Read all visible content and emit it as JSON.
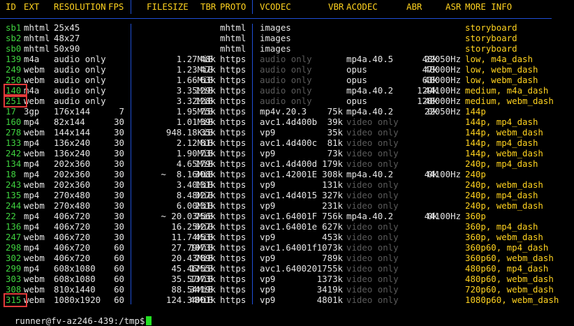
{
  "header": {
    "id": "ID",
    "ext": "EXT",
    "resolution": "RESOLUTION",
    "fps": "FPS",
    "filesize": "FILESIZE",
    "tbr": "TBR",
    "proto": "PROTO",
    "vcodec": "VCODEC",
    "vbr": "VBR",
    "acodec": "ACODEC",
    "abr": "ABR",
    "asr": "ASR",
    "more": "MORE INFO"
  },
  "rows": [
    {
      "id": "sb1",
      "ext": "mhtml",
      "res": "25x45",
      "fps": "",
      "size": "",
      "tbr": "",
      "proto": "mhtml",
      "vcodec": "images",
      "vcodec_dim": false,
      "vbr": "",
      "acodec": "",
      "abr": "",
      "asr": "",
      "more": "storyboard"
    },
    {
      "id": "sb2",
      "ext": "mhtml",
      "res": "48x27",
      "fps": "",
      "size": "",
      "tbr": "",
      "proto": "mhtml",
      "vcodec": "images",
      "vcodec_dim": false,
      "vbr": "",
      "acodec": "",
      "abr": "",
      "asr": "",
      "more": "storyboard"
    },
    {
      "id": "sb0",
      "ext": "mhtml",
      "res": "50x90",
      "fps": "",
      "size": "",
      "tbr": "",
      "proto": "mhtml",
      "vcodec": "images",
      "vcodec_dim": false,
      "vbr": "",
      "acodec": "",
      "abr": "",
      "asr": "",
      "more": "storyboard"
    },
    {
      "id": "139",
      "ext": "m4a",
      "res": "audio only",
      "fps": "",
      "size": "1.27MiB",
      "tbr": "48k",
      "proto": "https",
      "vcodec": "audio only",
      "vcodec_dim": true,
      "vbr": "",
      "acodec": "mp4a.40.5",
      "abr": "48k",
      "asr": "22050Hz",
      "more": "low, m4a_dash"
    },
    {
      "id": "249",
      "ext": "webm",
      "res": "audio only",
      "fps": "",
      "size": "1.23MiB",
      "tbr": "47k",
      "proto": "https",
      "vcodec": "audio only",
      "vcodec_dim": true,
      "vbr": "",
      "acodec": "opus",
      "abr": "47k",
      "asr": "48000Hz",
      "more": "low, webm_dash"
    },
    {
      "id": "250",
      "ext": "webm",
      "res": "audio only",
      "fps": "",
      "size": "1.66MiB",
      "tbr": "63k",
      "proto": "https",
      "vcodec": "audio only",
      "vcodec_dim": true,
      "vbr": "",
      "acodec": "opus",
      "abr": "63k",
      "asr": "48000Hz",
      "more": "low, webm_dash"
    },
    {
      "id": "140",
      "ext": "m4a",
      "res": "audio only",
      "fps": "",
      "size": "3.35MiB",
      "tbr": "129k",
      "proto": "https",
      "vcodec": "audio only",
      "vcodec_dim": true,
      "vbr": "",
      "acodec": "mp4a.40.2",
      "abr": "129k",
      "asr": "44100Hz",
      "more": "medium, m4a_dash"
    },
    {
      "id": "251",
      "ext": "webm",
      "res": "audio only",
      "fps": "",
      "size": "3.32MiB",
      "tbr": "128k",
      "proto": "https",
      "vcodec": "audio only",
      "vcodec_dim": true,
      "vbr": "",
      "acodec": "opus",
      "abr": "128k",
      "asr": "48000Hz",
      "more": "medium, webm_dash"
    },
    {
      "id": "17",
      "ext": "3gp",
      "res": "176x144",
      "fps": "7",
      "size": "1.95MiB",
      "tbr": "75k",
      "proto": "https",
      "vcodec": "mp4v.20.3",
      "vcodec_dim": false,
      "vbr": "75k",
      "acodec": "mp4a.40.2",
      "abr": "0k",
      "asr": "22050Hz",
      "more": "144p"
    },
    {
      "id": "160",
      "ext": "mp4",
      "res": "82x144",
      "fps": "30",
      "size": "1.01MiB",
      "tbr": "39k",
      "proto": "https",
      "vcodec": "avc1.4d400b",
      "vcodec_dim": false,
      "vbr": "39k",
      "acodec": "video only",
      "acodec_dim": true,
      "abr": "",
      "asr": "",
      "more": "144p, mp4_dash"
    },
    {
      "id": "278",
      "ext": "webm",
      "res": "144x144",
      "fps": "30",
      "size": "948.18KiB",
      "tbr": "35k",
      "proto": "https",
      "vcodec": "vp9",
      "vcodec_dim": false,
      "vbr": "35k",
      "acodec": "video only",
      "acodec_dim": true,
      "abr": "",
      "asr": "",
      "more": "144p, webm_dash"
    },
    {
      "id": "133",
      "ext": "mp4",
      "res": "136x240",
      "fps": "30",
      "size": "2.12MiB",
      "tbr": "81k",
      "proto": "https",
      "vcodec": "avc1.4d400c",
      "vcodec_dim": false,
      "vbr": "81k",
      "acodec": "video only",
      "acodec_dim": true,
      "abr": "",
      "asr": "",
      "more": "144p, mp4_dash"
    },
    {
      "id": "242",
      "ext": "webm",
      "res": "136x240",
      "fps": "30",
      "size": "1.90MiB",
      "tbr": "73k",
      "proto": "https",
      "vcodec": "vp9",
      "vcodec_dim": false,
      "vbr": "73k",
      "acodec": "video only",
      "acodec_dim": true,
      "abr": "",
      "asr": "",
      "more": "144p, webm_dash"
    },
    {
      "id": "134",
      "ext": "mp4",
      "res": "202x360",
      "fps": "30",
      "size": "4.65MiB",
      "tbr": "179k",
      "proto": "https",
      "vcodec": "avc1.4d400d",
      "vcodec_dim": false,
      "vbr": "179k",
      "acodec": "video only",
      "acodec_dim": true,
      "abr": "",
      "asr": "",
      "more": "240p, mp4_dash"
    },
    {
      "id": "18",
      "ext": "mp4",
      "res": "202x360",
      "fps": "30",
      "size": "~  8.16MiB",
      "tbr": "308k",
      "proto": "https",
      "vcodec": "avc1.42001E",
      "vcodec_dim": false,
      "vbr": "308k",
      "acodec": "mp4a.40.2",
      "abr": "0k",
      "asr": "44100Hz",
      "more": "240p"
    },
    {
      "id": "243",
      "ext": "webm",
      "res": "202x360",
      "fps": "30",
      "size": "3.40MiB",
      "tbr": "131k",
      "proto": "https",
      "vcodec": "vp9",
      "vcodec_dim": false,
      "vbr": "131k",
      "acodec": "video only",
      "acodec_dim": true,
      "abr": "",
      "asr": "",
      "more": "240p, webm_dash"
    },
    {
      "id": "135",
      "ext": "mp4",
      "res": "270x480",
      "fps": "30",
      "size": "8.48MiB",
      "tbr": "327k",
      "proto": "https",
      "vcodec": "avc1.4d4015",
      "vcodec_dim": false,
      "vbr": "327k",
      "acodec": "video only",
      "acodec_dim": true,
      "abr": "",
      "asr": "",
      "more": "240p, mp4_dash"
    },
    {
      "id": "244",
      "ext": "webm",
      "res": "270x480",
      "fps": "30",
      "size": "6.00MiB",
      "tbr": "231k",
      "proto": "https",
      "vcodec": "vp9",
      "vcodec_dim": false,
      "vbr": "231k",
      "acodec": "video only",
      "acodec_dim": true,
      "abr": "",
      "asr": "",
      "more": "240p, webm_dash"
    },
    {
      "id": "22",
      "ext": "mp4",
      "res": "406x720",
      "fps": "30",
      "size": "~ 20.03MiB",
      "tbr": "756k",
      "proto": "https",
      "vcodec": "avc1.64001F",
      "vcodec_dim": false,
      "vbr": "756k",
      "acodec": "mp4a.40.2",
      "abr": "0k",
      "asr": "44100Hz",
      "more": "360p"
    },
    {
      "id": "136",
      "ext": "mp4",
      "res": "406x720",
      "fps": "30",
      "size": "16.25MiB",
      "tbr": "627k",
      "proto": "https",
      "vcodec": "avc1.64001e",
      "vcodec_dim": false,
      "vbr": "627k",
      "acodec": "video only",
      "acodec_dim": true,
      "abr": "",
      "asr": "",
      "more": "360p, mp4_dash"
    },
    {
      "id": "247",
      "ext": "webm",
      "res": "406x720",
      "fps": "30",
      "size": "11.74MiB",
      "tbr": "453k",
      "proto": "https",
      "vcodec": "vp9",
      "vcodec_dim": false,
      "vbr": "453k",
      "acodec": "video only",
      "acodec_dim": true,
      "abr": "",
      "asr": "",
      "more": "360p, webm_dash"
    },
    {
      "id": "298",
      "ext": "mp4",
      "res": "406x720",
      "fps": "60",
      "size": "27.79MiB",
      "tbr": "1073k",
      "proto": "https",
      "vcodec": "avc1.64001f",
      "vcodec_dim": false,
      "vbr": "1073k",
      "acodec": "video only",
      "acodec_dim": true,
      "abr": "",
      "asr": "",
      "more": "360p60, mp4_dash"
    },
    {
      "id": "302",
      "ext": "webm",
      "res": "406x720",
      "fps": "60",
      "size": "20.43MiB",
      "tbr": "789k",
      "proto": "https",
      "vcodec": "vp9",
      "vcodec_dim": false,
      "vbr": "789k",
      "acodec": "video only",
      "acodec_dim": true,
      "abr": "",
      "asr": "",
      "more": "360p60, webm_dash"
    },
    {
      "id": "299",
      "ext": "mp4",
      "res": "608x1080",
      "fps": "60",
      "size": "45.46MiB",
      "tbr": "1755k",
      "proto": "https",
      "vcodec": "avc1.640020",
      "vcodec_dim": false,
      "vbr": "1755k",
      "acodec": "video only",
      "acodec_dim": true,
      "abr": "",
      "asr": "",
      "more": "480p60, mp4_dash"
    },
    {
      "id": "303",
      "ext": "webm",
      "res": "608x1080",
      "fps": "60",
      "size": "35.57MiB",
      "tbr": "1373k",
      "proto": "https",
      "vcodec": "vp9",
      "vcodec_dim": false,
      "vbr": "1373k",
      "acodec": "video only",
      "acodec_dim": true,
      "abr": "",
      "asr": "",
      "more": "480p60, webm_dash"
    },
    {
      "id": "308",
      "ext": "webm",
      "res": "810x1440",
      "fps": "60",
      "size": "88.54MiB",
      "tbr": "3419k",
      "proto": "https",
      "vcodec": "vp9",
      "vcodec_dim": false,
      "vbr": "3419k",
      "acodec": "video only",
      "acodec_dim": true,
      "abr": "",
      "asr": "",
      "more": "720p60, webm_dash"
    },
    {
      "id": "315",
      "ext": "webm",
      "res": "1080x1920",
      "fps": "60",
      "size": "124.34MiB",
      "tbr": "4801k",
      "proto": "https",
      "vcodec": "vp9",
      "vcodec_dim": false,
      "vbr": "4801k",
      "acodec": "video only",
      "acodec_dim": true,
      "abr": "",
      "asr": "",
      "more": "1080p60, webm_dash"
    }
  ],
  "highlighted_ids": [
    "140",
    "251",
    "315"
  ],
  "prompt": "runner@fv-az246-439:/tmp$",
  "colors": {
    "id": "#3fd13f",
    "header": "#ffd21f",
    "more_info": "#ffd21f",
    "dim": "#5a5a5a",
    "separator": "#1f4fd6",
    "highlight": "#e23a3a",
    "cursor": "#22e022"
  }
}
